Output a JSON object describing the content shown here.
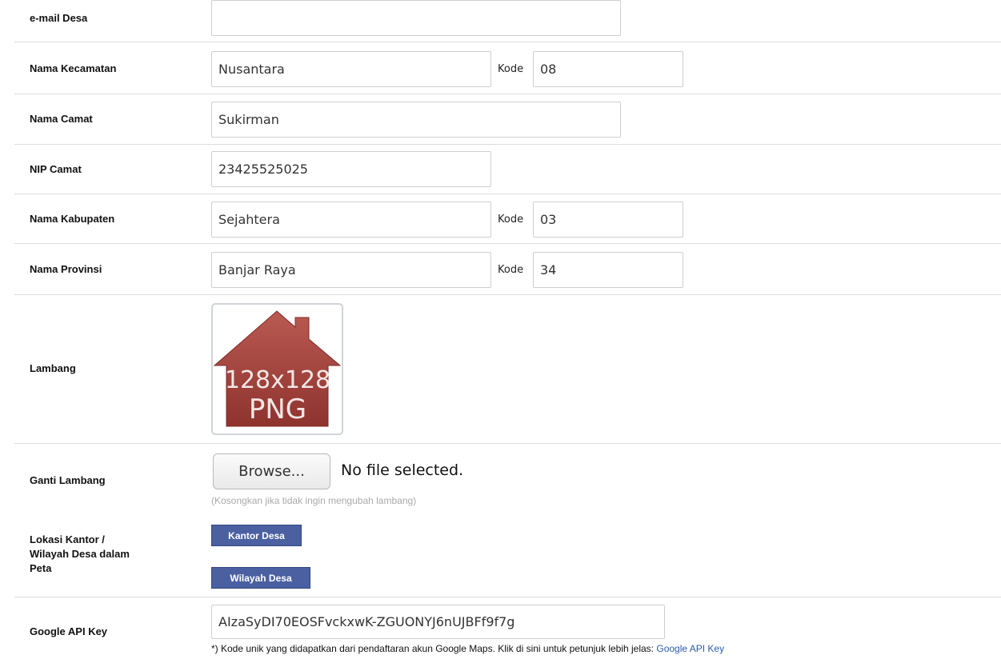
{
  "form": {
    "email_desa": {
      "label": "e-mail Desa",
      "value": ""
    },
    "nama_kecamatan": {
      "label": "Nama Kecamatan",
      "value": "Nusantara",
      "kode_label": "Kode",
      "kode_value": "08"
    },
    "nama_camat": {
      "label": "Nama Camat",
      "value": "Sukirman"
    },
    "nip_camat": {
      "label": "NIP Camat",
      "value": "23425525025"
    },
    "nama_kabupaten": {
      "label": "Nama Kabupaten",
      "value": "Sejahtera",
      "kode_label": "Kode",
      "kode_value": "03"
    },
    "nama_provinsi": {
      "label": "Nama Provinsi",
      "value": "Banjar Raya",
      "kode_label": "Kode",
      "kode_value": "34"
    },
    "lambang": {
      "label": "Lambang",
      "image_line1": "128x128",
      "image_line2": "PNG",
      "image_color": "#a9443e"
    },
    "ganti_lambang": {
      "label": "Ganti Lambang",
      "browse_label": "Browse...",
      "file_status": "No file selected.",
      "hint": "(Kosongkan jika tidak ingin mengubah lambang)"
    },
    "lokasi": {
      "label_line1": "Lokasi Kantor /",
      "label_line2": "Wilayah Desa dalam",
      "label_line3": "Peta",
      "kantor_button": "Kantor Desa",
      "wilayah_button": "Wilayah Desa",
      "button_color": "#4a60a1"
    },
    "google_api_key": {
      "label": "Google API Key",
      "value": "AIzaSyDI70EOSFvckxwK-ZGUONYJ6nUJBFf9f7g",
      "note": "*) Kode unik yang didapatkan dari pendaftaran akun Google Maps. Klik di sini untuk petunjuk lebih jelas: ",
      "note_link": "Google API Key",
      "link_color": "#2a5ca8"
    }
  }
}
